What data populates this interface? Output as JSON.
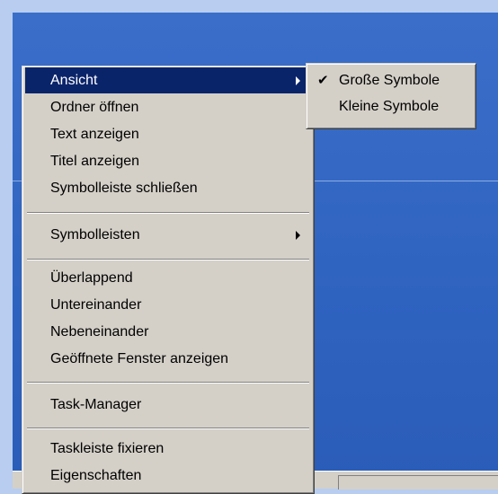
{
  "context_menu": {
    "items": [
      {
        "label": "Ansicht"
      },
      {
        "label": "Ordner öffnen"
      },
      {
        "label": "Text anzeigen"
      },
      {
        "label": "Titel anzeigen"
      },
      {
        "label": "Symbolleiste schließen"
      },
      {
        "label": "Symbolleisten"
      },
      {
        "label": "Überlappend"
      },
      {
        "label": "Untereinander"
      },
      {
        "label": "Nebeneinander"
      },
      {
        "label": "Geöffnete Fenster anzeigen"
      },
      {
        "label": "Task-Manager"
      },
      {
        "label": "Taskleiste fixieren"
      },
      {
        "label": "Eigenschaften"
      }
    ]
  },
  "submenu": {
    "items": [
      {
        "label": "Große Symbole",
        "checked": true
      },
      {
        "label": "Kleine Symbole",
        "checked": false
      }
    ],
    "check_glyph": "✔"
  },
  "colors": {
    "desktop": "#2f63c0",
    "menu_face": "#d4d0c8",
    "highlight": "#0a246a"
  }
}
